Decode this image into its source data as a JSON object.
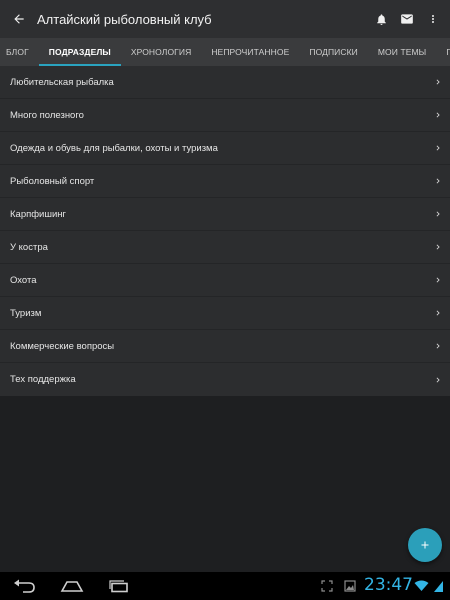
{
  "appbar": {
    "title": "Алтайский рыболовный клуб",
    "back_icon": "arrow-back-icon",
    "notifications_icon": "bell-icon",
    "messages_icon": "mail-icon",
    "menu_icon": "more-vert-icon"
  },
  "tabs": [
    {
      "label": "БЛОГ",
      "active": false
    },
    {
      "label": "ПОДРАЗДЕЛЫ",
      "active": true
    },
    {
      "label": "ХРОНОЛОГИЯ",
      "active": false
    },
    {
      "label": "НЕПРОЧИТАННОЕ",
      "active": false
    },
    {
      "label": "ПОДПИСКИ",
      "active": false
    },
    {
      "label": "МОИ ТЕМЫ",
      "active": false
    },
    {
      "label": "ПОПУЛЯРНОЕ",
      "active": false
    }
  ],
  "forums": [
    {
      "label": "Любительская рыбалка"
    },
    {
      "label": "Много полезного"
    },
    {
      "label": "Одежда и обувь для рыбалки, охоты и туризма"
    },
    {
      "label": "Рыболовный спорт"
    },
    {
      "label": "Карпфишинг"
    },
    {
      "label": "У костра"
    },
    {
      "label": "Охота"
    },
    {
      "label": "Туризм"
    },
    {
      "label": "Коммерческие вопросы"
    },
    {
      "label": "Тех поддержка"
    }
  ],
  "fab": {
    "icon": "plus-icon"
  },
  "system_bar": {
    "clock": "23:47",
    "clock_color": "#33b5e5"
  },
  "colors": {
    "accent": "#2aa3c0",
    "fab": "#2b9fba",
    "appbar": "#2e2f31",
    "tabs": "#3a3b3d",
    "list": "#2c2d2f",
    "background": "#1e1f21"
  }
}
